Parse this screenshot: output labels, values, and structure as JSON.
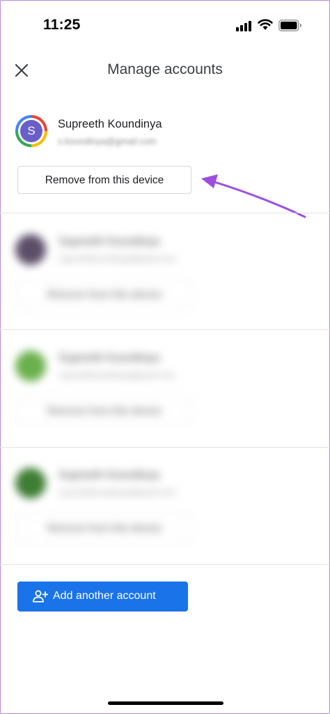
{
  "status_bar": {
    "time": "11:25",
    "signal_icon": "signal-bars-icon",
    "wifi_icon": "wifi-icon",
    "battery_icon": "battery-icon"
  },
  "header": {
    "title": "Manage accounts",
    "close_icon": "close-icon"
  },
  "primary_account": {
    "avatar_initial": "S",
    "name": "Supreeth Koundinya",
    "email": "s.koundinya@gmail.com",
    "remove_label": "Remove from this device"
  },
  "blurred_accounts": [
    {
      "name": "Supreeth Koundinya",
      "email": "supreethkoundinya@gmail.com",
      "remove_label": "Remove from this device",
      "avatar_color": "#5b4e68"
    },
    {
      "name": "Supreeth Koundinya",
      "email": "supreethkoundinya@gmail.com",
      "remove_label": "Remove from this device",
      "avatar_color": "#6ab04c"
    },
    {
      "name": "Supreeth Koundinya",
      "email": "supreethkoundinya@gmail.com",
      "remove_label": "Remove from this device",
      "avatar_color": "#3e7d34"
    }
  ],
  "add_account": {
    "label": "Add another account",
    "icon": "add-person-icon"
  },
  "colors": {
    "accent": "#1a73e8",
    "annotation_arrow": "#9b4fdc"
  }
}
